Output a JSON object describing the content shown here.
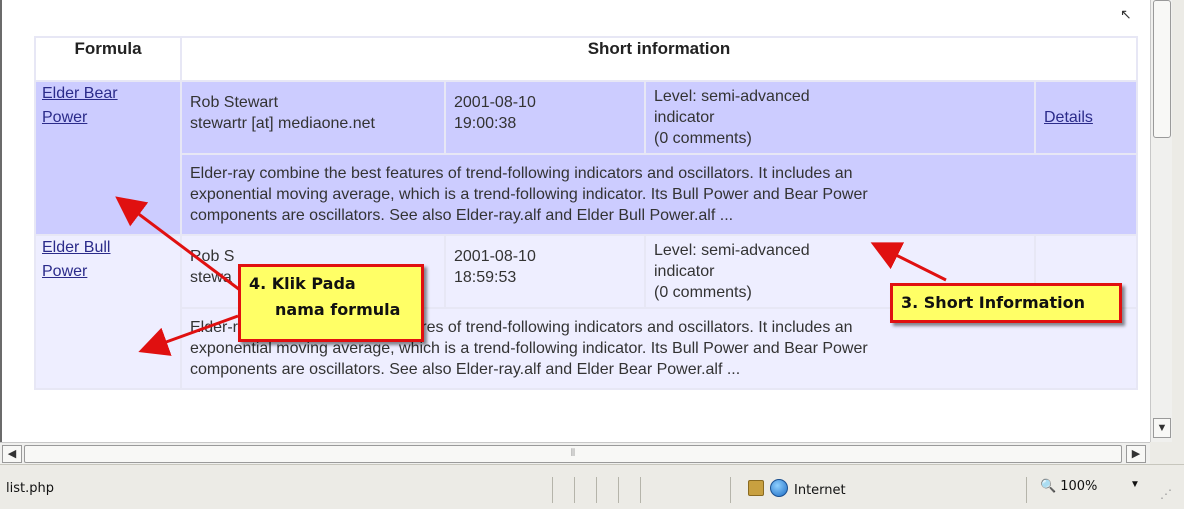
{
  "table": {
    "header_formula": "Formula",
    "header_info": "Short information",
    "rows": [
      {
        "formula_line1": "Elder Bear",
        "formula_line2": "Power",
        "author": "Rob Stewart",
        "email": "stewartr [at] mediaone.net",
        "date": "2001-08-10",
        "time": "19:00:38",
        "level": "Level: semi-advanced",
        "kind": "indicator",
        "comments": "(0 comments)",
        "details": "Details",
        "desc1": "Elder-ray combine the best features of trend-following indicators and oscillators. It includes an",
        "desc2": "exponential moving average, which is a trend-following indicator. Its Bull Power and Bear Power",
        "desc3": "components are oscillators. See also Elder-ray.alf and Elder Bull Power.alf ..."
      },
      {
        "formula_line1": "Elder Bull",
        "formula_line2": "Power",
        "author": "Rob S",
        "email": "stewa",
        "date": "2001-08-10",
        "time": "18:59:53",
        "level": "Level: semi-advanced",
        "kind": "indicator",
        "comments": "(0 comments)",
        "details": "",
        "desc1": "Elder-ray combine the best features of trend-following indicators and oscillators. It includes an",
        "desc2": "exponential moving average, which is a trend-following indicator. Its Bull Power and Bear Power",
        "desc3": "components are oscillators. See also Elder-ray.alf and Elder Bear Power.alf ..."
      }
    ]
  },
  "annotations": {
    "callout4_line1": "4. Klik Pada",
    "callout4_line2": "nama formula",
    "callout3": "3. Short Information"
  },
  "statusbar": {
    "url": "list.php",
    "zone": "Internet",
    "zoom": "100%"
  },
  "icons": {
    "zone": "globe-icon",
    "protected_mode": "lock-icon",
    "zoom": "magnifier-icon"
  },
  "colors": {
    "row_a_bg": "#ccccff",
    "row_b_bg": "#eeeeff",
    "callout_bg": "#ffff66",
    "callout_border": "#e01010",
    "link": "#2b2b8a"
  }
}
